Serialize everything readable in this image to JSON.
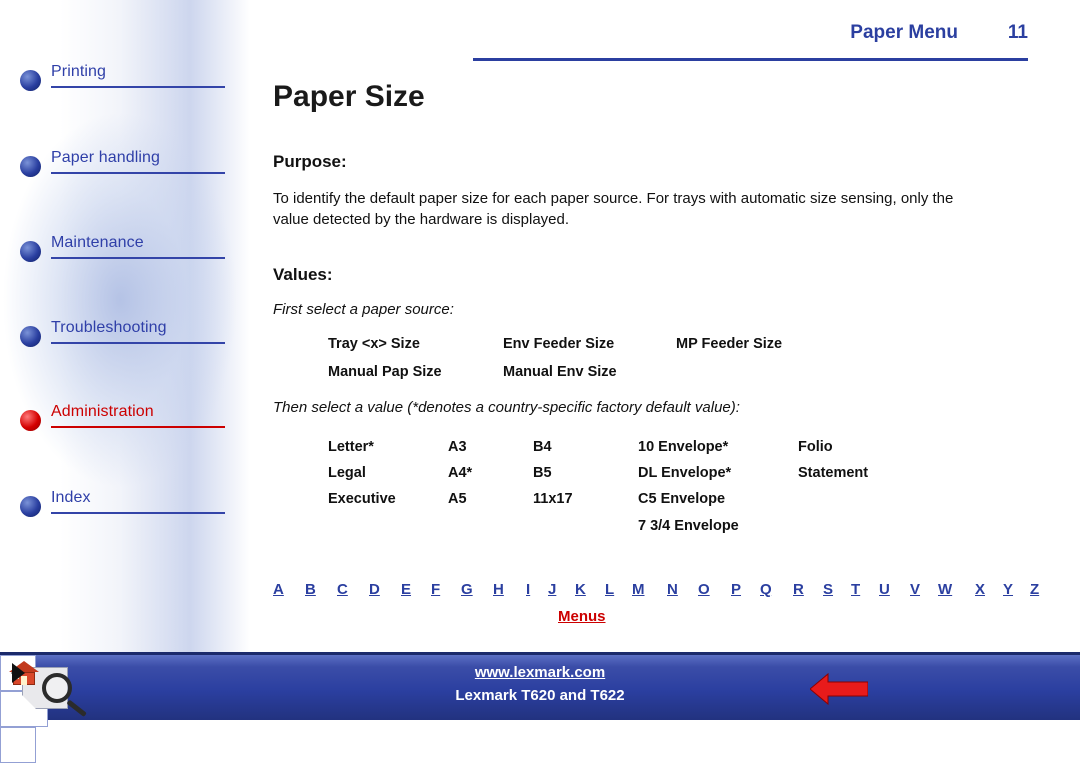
{
  "header": {
    "title": "Paper Menu",
    "page_number": "11"
  },
  "page_title": "Paper Size",
  "sections": {
    "purpose_heading": "Purpose:",
    "purpose_text": "To identify the default paper size for each paper source. For trays with automatic size sensing, only the value detected by the hardware is displayed.",
    "values_heading": "Values:",
    "source_note": "First select a paper source:",
    "sources": [
      [
        "Tray <x> Size",
        "Env Feeder Size",
        "MP Feeder Size"
      ],
      [
        "Manual Pap Size",
        "Manual Env Size",
        ""
      ]
    ],
    "value_note": "Then select a value (*denotes a country-specific factory default value):",
    "values": [
      [
        "Letter*",
        "A3",
        "B4",
        "10 Envelope*",
        "Folio"
      ],
      [
        "Legal",
        "A4*",
        "B5",
        "DL Envelope*",
        "Statement"
      ],
      [
        "Executive",
        "A5",
        "11x17",
        "C5 Envelope",
        ""
      ],
      [
        "",
        "",
        "",
        "7 3/4 Envelope",
        ""
      ]
    ]
  },
  "sidebar": {
    "items": [
      {
        "label": "Printing",
        "color": "blue"
      },
      {
        "label": "Paper handling",
        "color": "blue"
      },
      {
        "label": "Maintenance",
        "color": "blue"
      },
      {
        "label": "Troubleshooting",
        "color": "blue"
      },
      {
        "label": "Administration",
        "color": "red"
      },
      {
        "label": "Index",
        "color": "blue"
      }
    ]
  },
  "index_links": {
    "letters": [
      "A",
      "B",
      "C",
      "D",
      "E",
      "F",
      "G",
      "H",
      "I",
      "J",
      "K",
      "L",
      "M",
      "N",
      "O",
      "P",
      "Q",
      "R",
      "S",
      "T",
      "U",
      "V",
      "W",
      "X",
      "Y",
      "Z"
    ],
    "menus_label": "Menus"
  },
  "footer": {
    "url": "www.lexmark.com",
    "model": "Lexmark T620 and T622"
  },
  "colors": {
    "accent_blue": "#2b3fa0",
    "accent_red": "#cc0000",
    "footer_bg": "#2b3fa0"
  }
}
